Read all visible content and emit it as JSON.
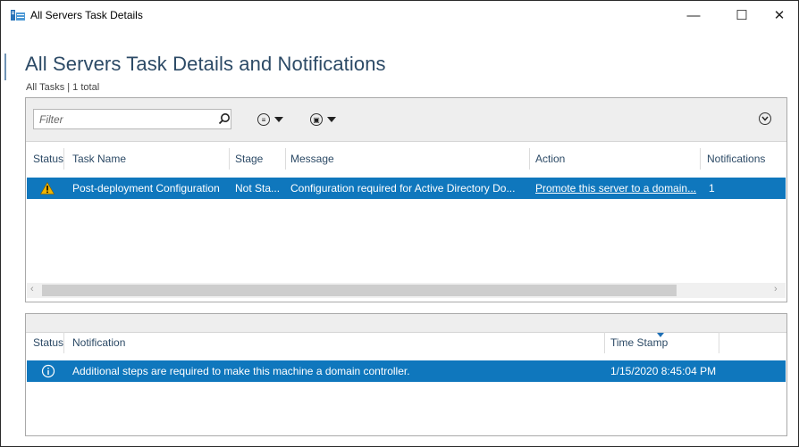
{
  "window": {
    "title": "All Servers Task Details",
    "controls": {
      "minimize": "—",
      "maximize": "☐",
      "close": "✕"
    }
  },
  "page": {
    "title": "All Servers Task Details and Notifications",
    "subtitle": "All Tasks | 1 total"
  },
  "toolbar": {
    "filter_placeholder": "Filter",
    "icons": [
      "search-icon",
      "list-options-icon",
      "save-icon",
      "expand-icon"
    ]
  },
  "tasks": {
    "columns": [
      "Status",
      "Task Name",
      "Stage",
      "Message",
      "Action",
      "Notifications"
    ],
    "rows": [
      {
        "status_icon": "warning-icon",
        "task_name": "Post-deployment Configuration",
        "stage": "Not Sta...",
        "message": "Configuration required for Active Directory Do...",
        "action": "Promote this server to a domain...",
        "notifications": "1"
      }
    ]
  },
  "notifications": {
    "columns": [
      "Status",
      "Notification",
      "Time Stamp"
    ],
    "rows": [
      {
        "status_icon": "info-icon",
        "notification": "Additional steps are required to make this machine a domain controller.",
        "time_stamp": "1/15/2020 8:45:04 PM"
      }
    ]
  },
  "colors": {
    "selection": "#0f77bd",
    "heading": "#2c4a66",
    "warning": "#f0b400"
  }
}
